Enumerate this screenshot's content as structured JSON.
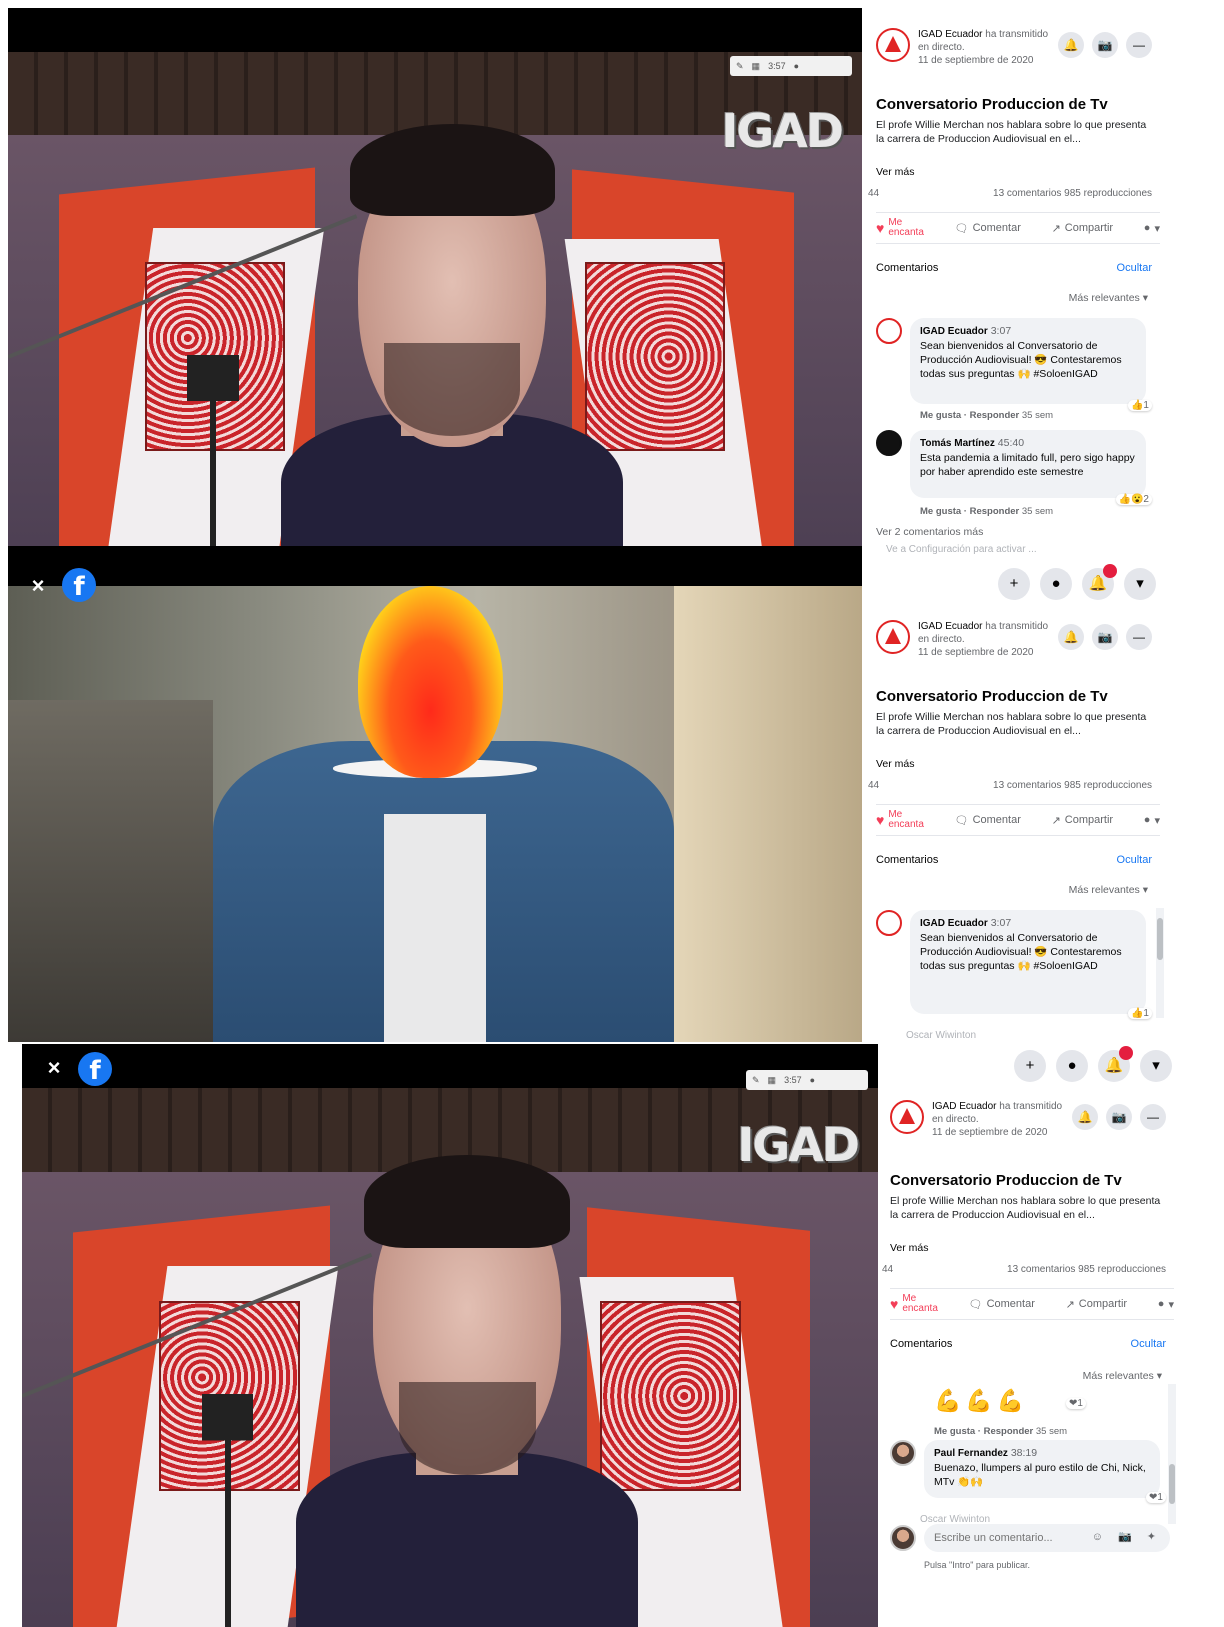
{
  "colors": {
    "facebook_blue": "#1877f2",
    "igad_red": "#e02424",
    "love_red": "#f33e58",
    "notification_red": "#e41e3f"
  },
  "icons": {
    "close": "×",
    "facebook": "f",
    "bell": "🔔",
    "camera": "📷",
    "more": "—",
    "heart": "♥",
    "comment": "🗨",
    "share": "↗",
    "plus": "+",
    "messenger": "●",
    "down": "▾"
  },
  "video": {
    "logo": "IGAD",
    "toolbar_time": "3:57"
  },
  "post": {
    "page_name": "IGAD Ecuador",
    "status": "ha transmitido en directo.",
    "date": "11 de septiembre de 2020",
    "title": "Conversatorio Produccion de Tv",
    "description": "El profe Willie Merchan nos hablara sobre lo que presenta la carrera de Produccion Audiovisual en el...",
    "see_more": "Ver más",
    "stats_left": "44",
    "stats": "13 comentarios  985 reproducciones",
    "action_love_1": "Me",
    "action_love_2": "encanta",
    "action_comment": "Comentar",
    "action_share": "Compartir",
    "comments_label": "Comentarios",
    "hide_label": "Ocultar",
    "relevant_label": "Más relevantes ▾",
    "view_more_comments": "Ver 2 comentarios más",
    "settings_hint": "Ve a Configuración para activar ..."
  },
  "comments": {
    "c1": {
      "author": "IGAD Ecuador",
      "time": "3:07",
      "text": "Sean bienvenidos al Conversatorio de Producción Audiovisual! 😎 Contestaremos todas sus preguntas 🙌 #SoloenIGAD",
      "actions": "Me gusta · Responder",
      "ago": "35 sem",
      "reactions": "👍1"
    },
    "c2": {
      "author": "Tomás Martínez",
      "time": "45:40",
      "text": "Esta pandemia a limitado full, pero sigo happy por haber aprendido este semestre",
      "actions": "Me gusta · Responder",
      "ago": "35 sem",
      "reactions": "👍😮2"
    },
    "c3": {
      "emoji": "💪💪💪",
      "actions": "Me gusta · Responder",
      "ago": "35 sem",
      "reactions": "❤1"
    },
    "c4": {
      "author": "Paul Fernandez",
      "time": "38:19",
      "text": "Buenazo, llumpers al puro estilo de Chi, Nick, MTv 👏🙌",
      "reactions": "❤1"
    },
    "next_author": "Oscar Wiwinton"
  },
  "composer": {
    "placeholder": "Escribe un comentario...",
    "icons": "☺ 📷 ✦",
    "hint": "Pulsa \"Intro\" para publicar."
  }
}
